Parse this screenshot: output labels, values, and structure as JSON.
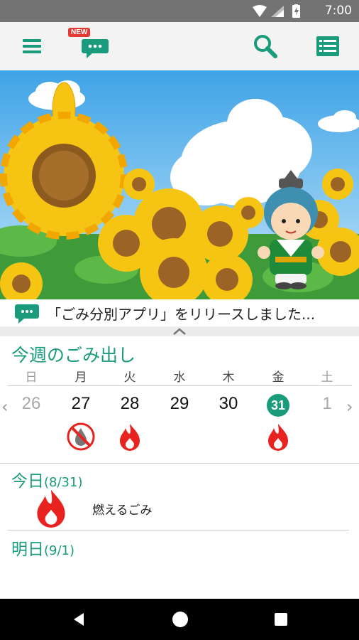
{
  "status": {
    "time": "7:00"
  },
  "header": {
    "new_badge": "NEW"
  },
  "news": {
    "text": "「ごみ分別アプリ」をリリースしました..."
  },
  "week": {
    "title": "今週のごみ出し",
    "days_of_week": [
      "日",
      "月",
      "火",
      "水",
      "木",
      "金",
      "土"
    ],
    "dates": [
      "26",
      "27",
      "28",
      "29",
      "30",
      "31",
      "1"
    ],
    "today_index": 5,
    "icons": [
      {
        "day": "27",
        "icon": "no-burn-trash-icon"
      },
      {
        "day": "28",
        "icon": "burnable-trash-icon"
      },
      {
        "day": "31",
        "icon": "burnable-trash-icon"
      }
    ]
  },
  "today": {
    "label": "今日",
    "date": "(8/31)",
    "item": "燃えるごみ",
    "icon": "burnable-trash-icon"
  },
  "tomorrow": {
    "label": "明日",
    "date": "(9/1)"
  },
  "colors": {
    "accent": "#1a9b7b",
    "fire": "#e8231f"
  }
}
